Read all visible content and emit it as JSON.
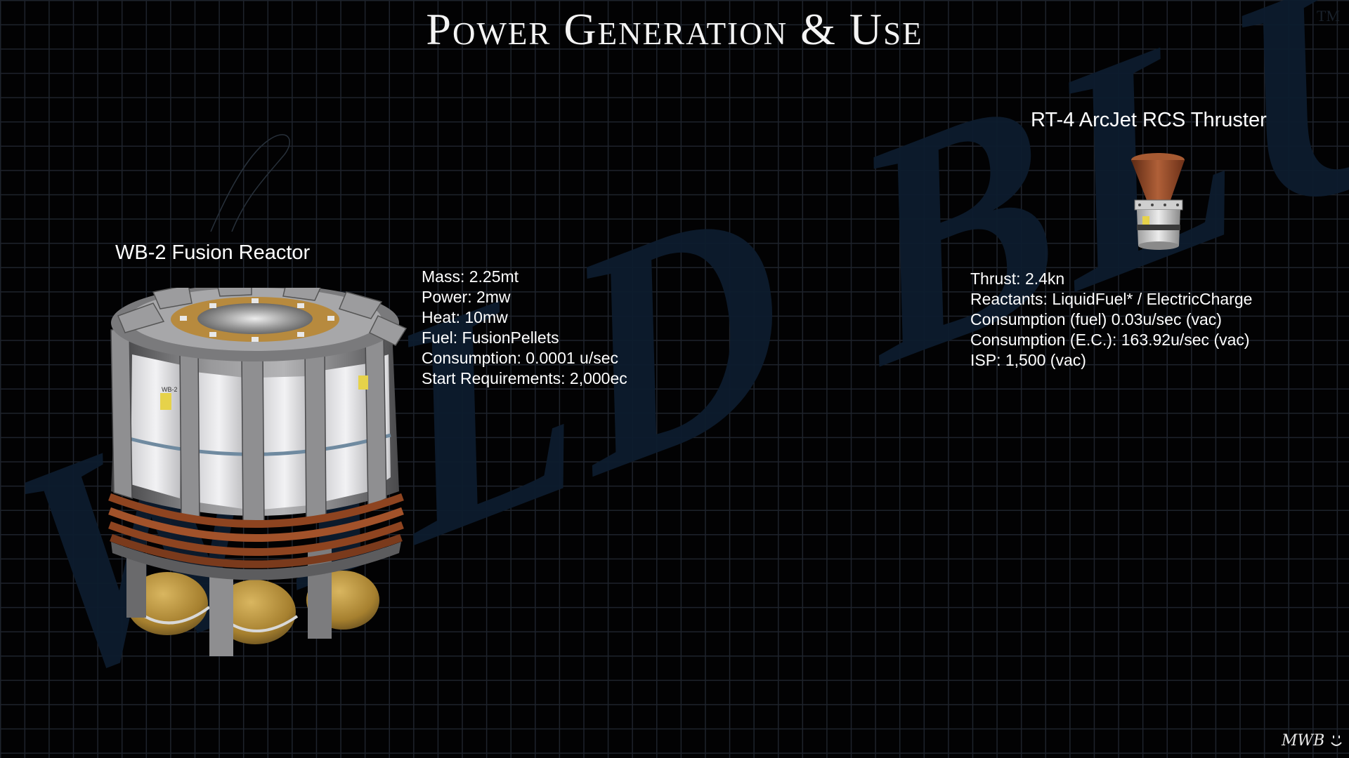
{
  "title": "Power Generation & Use",
  "watermark": {
    "text": "WILD BLUE",
    "trademark": "TM",
    "color": "#0e1e30"
  },
  "reactor": {
    "name": "WB-2 Fusion Reactor",
    "decal": "WB-2",
    "specs": [
      "Mass: 2.25mt",
      "Power: 2mw",
      "Heat: 10mw",
      "Fuel: FusionPellets",
      "Consumption: 0.0001 u/sec",
      "Start Requirements: 2,000ec"
    ]
  },
  "thruster": {
    "name": "RT-4 ArcJet RCS Thruster",
    "specs": [
      "Thrust: 2.4kn",
      "Reactants: LiquidFuel* / ElectricCharge",
      "Consumption (fuel) 0.03u/sec (vac)",
      "Consumption (E.C.): 163.92u/sec (vac)",
      "ISP: 1,500 (vac)"
    ]
  },
  "signature": "MWB",
  "colors": {
    "background": "#020203",
    "grid": "#1e232c",
    "text": "#ffffff",
    "reactor_metal": "#8a8a8a",
    "reactor_coil": "#9a4a22",
    "reactor_tank": "#b8923c",
    "thruster_nozzle": "#9a4a28"
  }
}
